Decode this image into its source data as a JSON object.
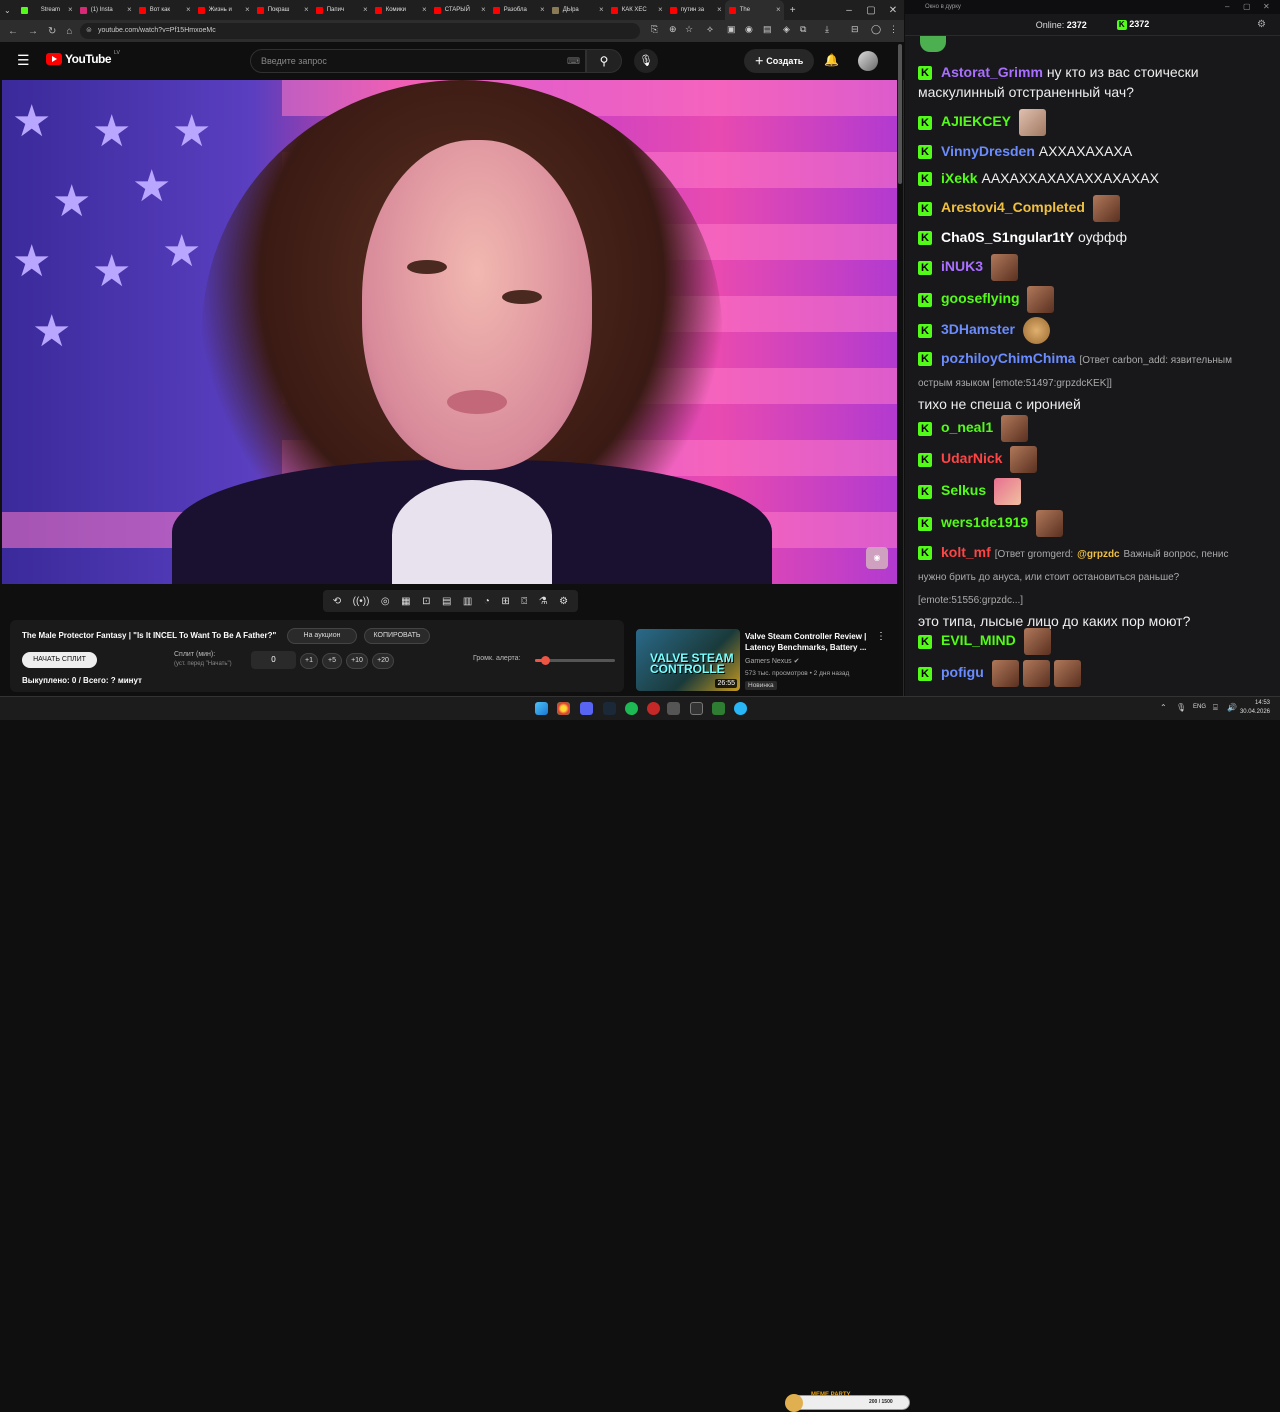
{
  "browser": {
    "tabs": [
      {
        "label": "Stream",
        "icon": "kick"
      },
      {
        "label": "(1) Insta",
        "icon": "instagram"
      },
      {
        "label": "Вот как",
        "icon": "youtube"
      },
      {
        "label": "Жизнь и",
        "icon": "youtube"
      },
      {
        "label": "Покраш",
        "icon": "youtube"
      },
      {
        "label": "Папич",
        "icon": "youtube"
      },
      {
        "label": "Комики",
        "icon": "youtube"
      },
      {
        "label": "СТАРЫЙ",
        "icon": "youtube"
      },
      {
        "label": "Разобла",
        "icon": "youtube"
      },
      {
        "label": "ДЫра",
        "icon": "dyra"
      },
      {
        "label": "КАК ХЕС",
        "icon": "youtube"
      },
      {
        "label": "путин за",
        "icon": "youtube"
      },
      {
        "label": "The",
        "icon": "youtube",
        "active": true
      }
    ],
    "url": "youtube.com/watch?v=Pf15HmxoeMc"
  },
  "youtube": {
    "logo_text": "YouTube",
    "logo_country": "LV",
    "search_placeholder": "Введите запрос",
    "create_label": "Создать"
  },
  "panel": {
    "title": "The Male Protector Fantasy | \"Is It INCEL To Want To Be A Father?\"",
    "auction_label": "На аукцион",
    "copy_label": "КОПИРОВАТЬ",
    "start_split_label": "НАЧАТЬ СПЛИТ",
    "split_label": "Сплит (мин):",
    "split_sub": "(уст. перед \"Начать\")",
    "split_value": "0",
    "increments": [
      "+1",
      "+5",
      "+10",
      "+20"
    ],
    "alert_label": "Громк. алерта:",
    "alert_level": 0.12,
    "bought_text": "Выкуплено: 0 / Всего: ? минут"
  },
  "recommendation": {
    "title": "Valve Steam Controller Review | Latency Benchmarks, Battery ...",
    "channel": "Gamers Nexus",
    "meta": "573 тыс. просмотров • 2 дня назад",
    "badge": "Новинка",
    "duration": "26:55",
    "thumb_text_1": "VALVE STEAM",
    "thumb_text_2": "CONTROLLE"
  },
  "chat": {
    "window_title": "Окно в дурку",
    "online_label": "Online:",
    "online_count": "2372",
    "viewers_count": "2372",
    "messages": [
      {
        "user": "Astorat_Grimm",
        "color": "#a970ff",
        "text": "ну кто из вас стоически маскулинный отстраненный чач?"
      },
      {
        "user": "AJIEKCEY",
        "color": "#53fc18",
        "text": ""
      },
      {
        "user": "VinnyDresden",
        "color": "#6b8cff",
        "text": "АХХАХАХАХА"
      },
      {
        "user": "iXekk",
        "color": "#53fc18",
        "text": "ААХАХХАХАХАХХАХАХАХ"
      },
      {
        "user": "Arestovi4_Completed",
        "color": "#f0c040",
        "text": ""
      },
      {
        "user": "Cha0S_S1ngular1tY",
        "color": "#ffffff",
        "text": "оуффф"
      },
      {
        "user": "iNUK3",
        "color": "#a970ff",
        "text": ""
      },
      {
        "user": "gooseflying",
        "color": "#53fc18",
        "text": ""
      },
      {
        "user": "3DHamster",
        "color": "#6b8cff",
        "text": ""
      },
      {
        "user": "pozhiloyChimChima",
        "color": "#6b8cff",
        "reply": "[Ответ carbon_add: язвительным острым языком [emote:51497:grpzdcKEK]]",
        "text": "тихо не спеша с иронией"
      },
      {
        "user": "o_neal1",
        "color": "#53fc18",
        "text": ""
      },
      {
        "user": "UdarNick",
        "color": "#ff4444",
        "text": ""
      },
      {
        "user": "Selkus",
        "color": "#53fc18",
        "text": ""
      },
      {
        "user": "wers1de1919",
        "color": "#53fc18",
        "text": ""
      },
      {
        "user": "kolt_mf",
        "color": "#ff4444",
        "reply": "[Ответ gromgerd:",
        "mention": "@grpzdc",
        "reply2": "Важный вопрос, пенис нужно брить до ануса, или стоит остановиться раньше? [emote:51556:grpzdc...]",
        "text": "это типа, лысые лицо до каких пор моют?"
      },
      {
        "user": "EVIL_MIND",
        "color": "#53fc18",
        "text": ""
      },
      {
        "user": "pofigu",
        "color": "#6b8cff",
        "text": ""
      }
    ]
  },
  "taskbar": {
    "lang": "ENG",
    "time": "14:53",
    "date": "30.04.2026",
    "meme_label": "MEME PARTY",
    "meme_count": "200 / 1500"
  }
}
